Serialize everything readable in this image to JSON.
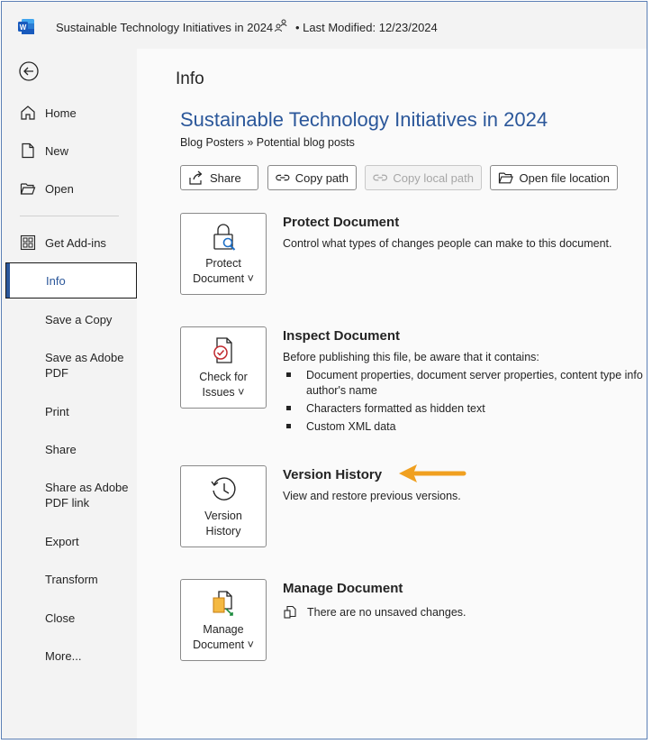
{
  "window": {
    "title": "Sustainable Technology Initiatives in 2024",
    "last_modified": "• Last Modified: 12/23/2024"
  },
  "sidebar": {
    "items": [
      {
        "label": "Home",
        "icon": "home-icon"
      },
      {
        "label": "New",
        "icon": "new-document-icon"
      },
      {
        "label": "Open",
        "icon": "folder-open-icon"
      },
      {
        "label": "Get Add-ins",
        "icon": "add-ins-grid-icon"
      },
      {
        "label": "Info"
      },
      {
        "label": "Save a Copy"
      },
      {
        "label": "Save as Adobe PDF"
      },
      {
        "label": "Print"
      },
      {
        "label": "Share"
      },
      {
        "label": "Share as Adobe PDF link"
      },
      {
        "label": "Export"
      },
      {
        "label": "Transform"
      },
      {
        "label": "Close"
      },
      {
        "label": "More..."
      }
    ]
  },
  "main": {
    "heading": "Info",
    "doc_title": "Sustainable Technology Initiatives in 2024",
    "breadcrumb": "Blog Posters » Potential blog posts",
    "buttons": {
      "share": "Share",
      "copy_path": "Copy path",
      "copy_local_path": "Copy local path",
      "open_location": "Open file location"
    },
    "protect": {
      "card_label_1": "Protect",
      "card_label_2": "Document ˅",
      "title": "Protect Document",
      "desc": "Control what types of changes people can make to this document."
    },
    "inspect": {
      "card_label_1": "Check for",
      "card_label_2": "Issues ˅",
      "title": "Inspect Document",
      "desc": "Before publishing this file, be aware that it contains:",
      "bullets": [
        "Document properties, document server properties, content type info",
        "author's name",
        "Characters formatted as hidden text",
        "Custom XML data"
      ]
    },
    "version": {
      "card_label_1": "Version",
      "card_label_2": "History",
      "title": "Version History",
      "desc": "View and restore previous versions."
    },
    "manage": {
      "card_label_1": "Manage",
      "card_label_2": "Document ˅",
      "title": "Manage Document",
      "desc": "There are no unsaved changes."
    }
  },
  "colors": {
    "accent": "#2b579a",
    "arrow": "#f0a020"
  }
}
